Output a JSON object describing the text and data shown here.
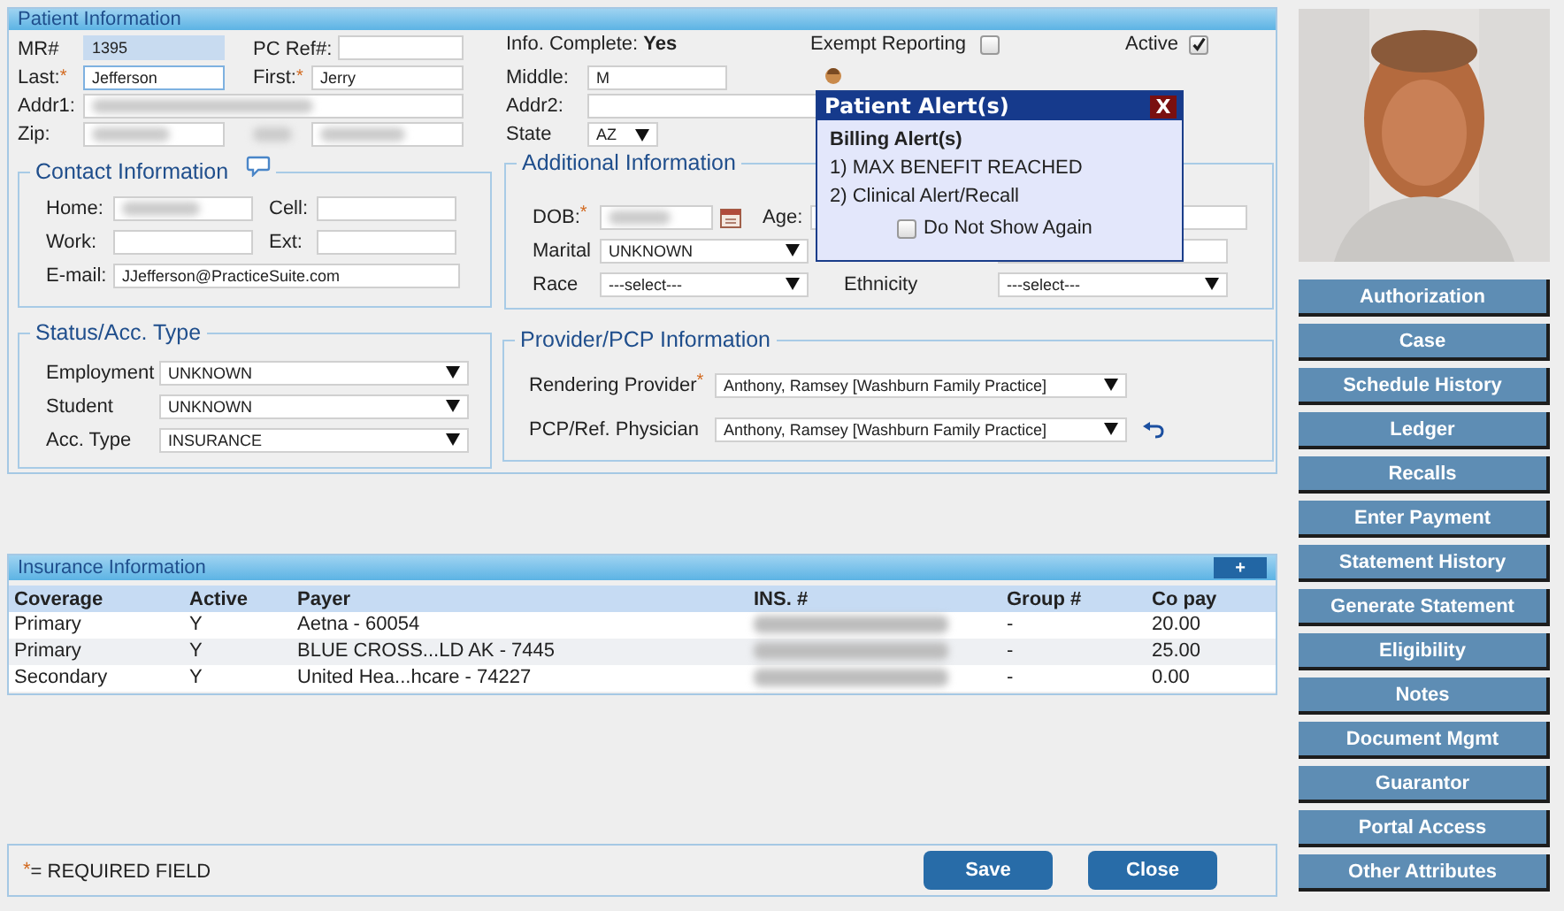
{
  "panel_title": "Patient Information",
  "mr": {
    "label": "MR#",
    "value": "1395"
  },
  "pc_ref": {
    "label": "PC Ref#:"
  },
  "info_complete": {
    "label": "Info. Complete:",
    "value": "Yes"
  },
  "exempt_reporting": {
    "label": "Exempt Reporting",
    "checked": false
  },
  "active": {
    "label": "Active",
    "checked": true
  },
  "last": {
    "label": "Last:",
    "required_mark": "*",
    "value": "Jefferson",
    "focused": true
  },
  "first": {
    "label": "First:",
    "required_mark": "*",
    "value": "Jerry"
  },
  "middle": {
    "label": "Middle:",
    "value": "M"
  },
  "addr1": {
    "label": "Addr1:",
    "redacted": true
  },
  "addr2": {
    "label": "Addr2:"
  },
  "zip": {
    "label": "Zip:",
    "redacted": true
  },
  "city": {
    "redacted_label": true,
    "redacted": true
  },
  "state": {
    "label": "State",
    "value": "AZ"
  },
  "contact": {
    "title": "Contact Information",
    "fields": [
      {
        "label": "Home:",
        "redacted": true
      },
      {
        "label": "Cell:"
      },
      {
        "label": "Work:"
      },
      {
        "label": "Ext:"
      },
      {
        "label": "E-mail:",
        "value": "JJefferson@PracticeSuite.com"
      }
    ]
  },
  "additional": {
    "title": "Additional Information",
    "dob": {
      "label": "DOB:",
      "required_mark": "*",
      "redacted": true
    },
    "age": {
      "label": "Age:"
    },
    "marital": {
      "label": "Marital",
      "value": "UNKNOWN"
    },
    "race": {
      "label": "Race",
      "value": "---select---"
    },
    "ethnicity": {
      "label": "Ethnicity",
      "value": "---select---"
    }
  },
  "status": {
    "title": "Status/Acc. Type",
    "fields": [
      {
        "label": "Employment",
        "value": "UNKNOWN"
      },
      {
        "label": "Student",
        "value": "UNKNOWN"
      },
      {
        "label": "Acc. Type",
        "value": "INSURANCE"
      }
    ]
  },
  "provider": {
    "title": "Provider/PCP Information",
    "fields": [
      {
        "label": "Rendering Provider",
        "required_mark": "*",
        "value": "Anthony, Ramsey [Washburn Family Practice]",
        "reset": false
      },
      {
        "label": "PCP/Ref. Physician",
        "value": "Anthony, Ramsey [Washburn Family Practice]",
        "reset": true
      }
    ]
  },
  "alert": {
    "title": "Patient Alert(s)",
    "close": "X",
    "heading": "Billing Alert(s)",
    "items": [
      "1) MAX BENEFIT REACHED",
      "2) Clinical Alert/Recall"
    ],
    "do_not_show": {
      "label": "Do Not Show Again",
      "checked": false
    }
  },
  "insurance": {
    "title": "Insurance Information",
    "add": "+",
    "columns": [
      "Coverage",
      "Active",
      "Payer",
      "INS. #",
      "Group #",
      "Co pay"
    ],
    "rows": [
      {
        "coverage": "Primary",
        "active": "Y",
        "payer": "Aetna - 60054",
        "ins_redacted": true,
        "group": "-",
        "copay": "20.00"
      },
      {
        "coverage": "Primary",
        "active": "Y",
        "payer": "BLUE CROSS...LD AK - 7445",
        "ins_redacted": true,
        "group": "-",
        "copay": "25.00"
      },
      {
        "coverage": "Secondary",
        "active": "Y",
        "payer": "United Hea...hcare - 74227",
        "ins_redacted": true,
        "group": "-",
        "copay": "0.00"
      }
    ]
  },
  "footer": {
    "mark": "*",
    "note": "= REQUIRED FIELD",
    "buttons": [
      "Save",
      "Close"
    ]
  },
  "side_buttons": [
    "Authorization",
    "Case",
    "Schedule History",
    "Ledger",
    "Recalls",
    "Enter Payment",
    "Statement History",
    "Generate Statement",
    "Eligibility",
    "Notes",
    "Document Mgmt",
    "Guarantor",
    "Portal Access",
    "Other Attributes"
  ]
}
